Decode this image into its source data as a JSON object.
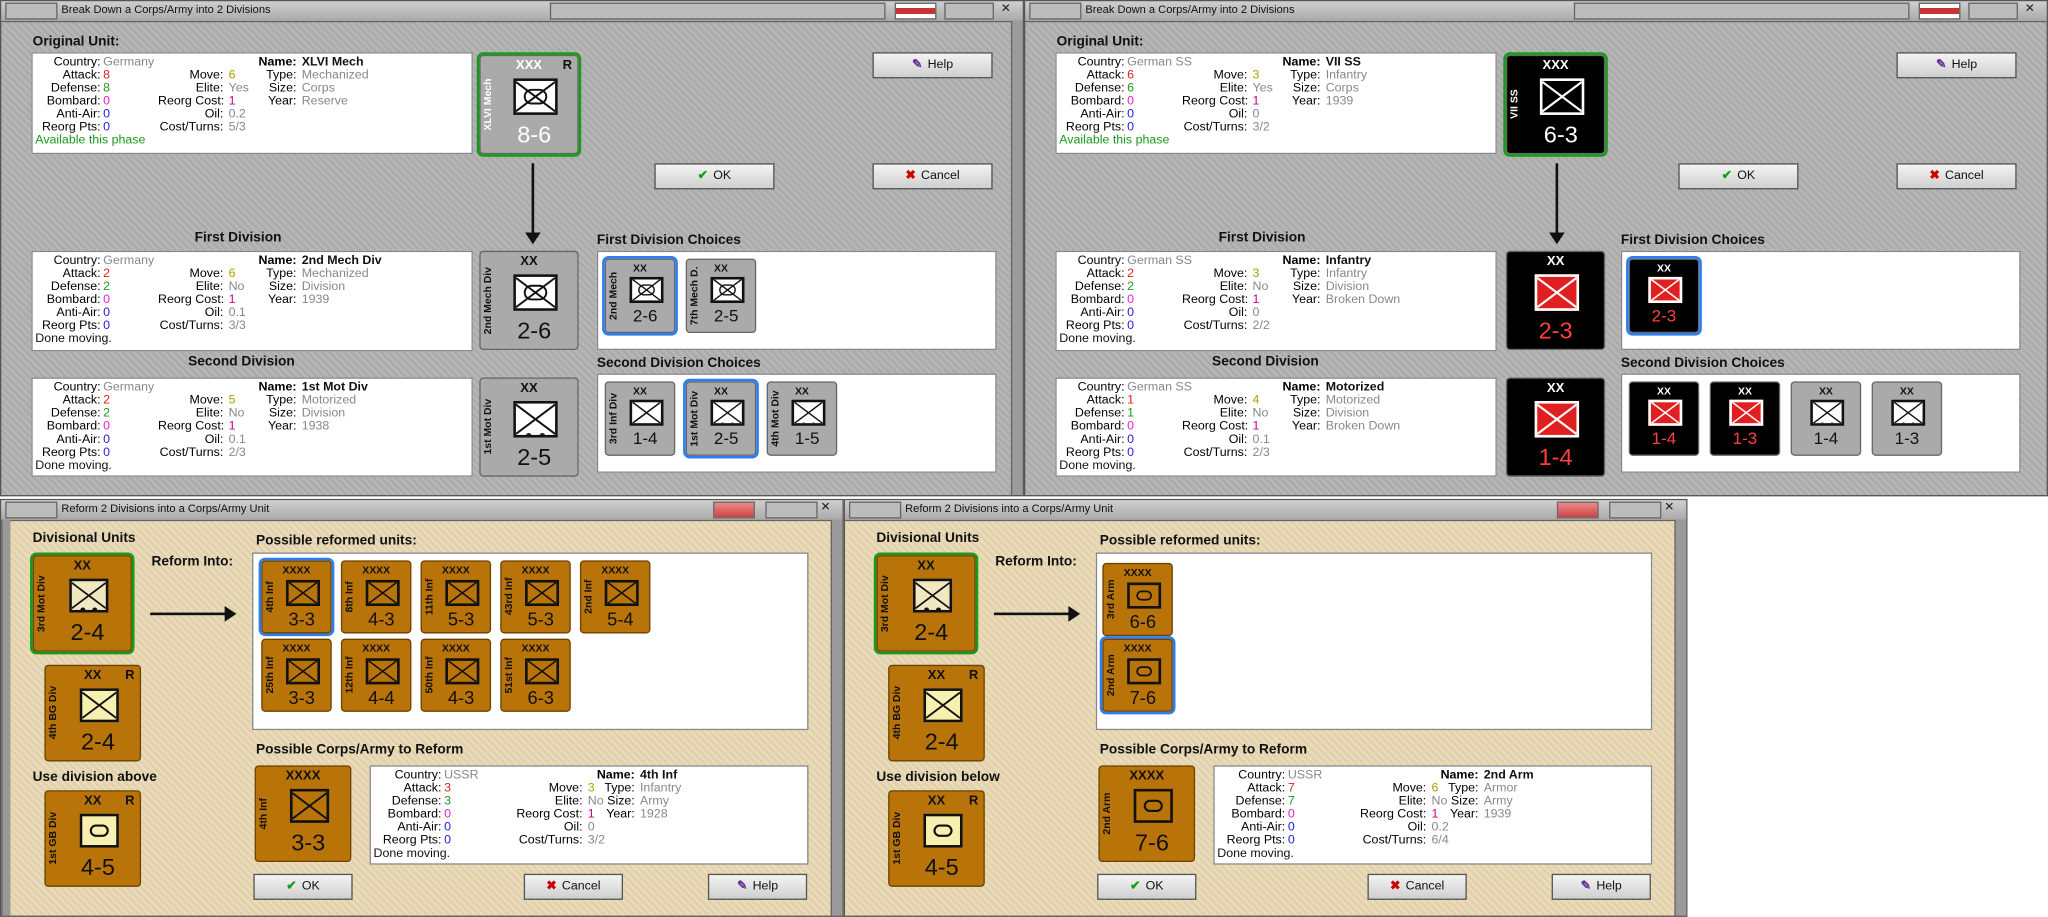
{
  "win1": {
    "title": "Break Down a Corps/Army into 2 Divisions",
    "original_label": "Original Unit:",
    "first_label": "First Division",
    "second_label": "Second Division",
    "first_choices_label": "First Division Choices",
    "second_choices_label": "Second Division Choices",
    "help": "Help",
    "ok": "OK",
    "cancel": "Cancel",
    "orig": {
      "country_l": "Country:",
      "country": "Germany",
      "attack_l": "Attack:",
      "attack": "8",
      "defense_l": "Defense:",
      "defense": "8",
      "bombard_l": "Bombard:",
      "bombard": "0",
      "antiair_l": "Anti-Air:",
      "antiair": "0",
      "reorg_l": "Reorg Pts:",
      "reorg": "0",
      "move_l": "Move:",
      "move": "6",
      "elite_l": "Elite:",
      "elite": "Yes",
      "rcost_l": "Reorg Cost:",
      "rcost": "1",
      "oil_l": "Oil:",
      "oil": "0.2",
      "ct_l": "Cost/Turns:",
      "ct": "5/3",
      "name_l": "Name:",
      "name": "XLVI Mech",
      "type_l": "Type:",
      "type": "Mechanized",
      "size_l": "Size:",
      "size": "Corps",
      "year_l": "Year:",
      "year": "Reserve",
      "status": "Available this phase"
    },
    "orig_counter": {
      "side": "XLVI Mech",
      "ech": "XXX",
      "r": "R",
      "str": "8-6"
    },
    "first": {
      "country_l": "Country:",
      "country": "Germany",
      "attack_l": "Attack:",
      "attack": "2",
      "defense_l": "Defense:",
      "defense": "2",
      "bombard_l": "Bombard:",
      "bombard": "0",
      "antiair_l": "Anti-Air:",
      "antiair": "0",
      "reorg_l": "Reorg Pts:",
      "reorg": "0",
      "move_l": "Move:",
      "move": "6",
      "elite_l": "Elite:",
      "elite": "No",
      "rcost_l": "Reorg Cost:",
      "rcost": "1",
      "oil_l": "Oil:",
      "oil": "0.1",
      "ct_l": "Cost/Turns:",
      "ct": "3/3",
      "name_l": "Name:",
      "name": "2nd Mech Div",
      "type_l": "Type:",
      "type": "Mechanized",
      "size_l": "Size:",
      "size": "Division",
      "year_l": "Year:",
      "year": "1939",
      "status": "Done moving."
    },
    "first_counter": {
      "side": "2nd Mech Div",
      "ech": "XX",
      "str": "2-6"
    },
    "second": {
      "country_l": "Country:",
      "country": "Germany",
      "attack_l": "Attack:",
      "attack": "2",
      "defense_l": "Defense:",
      "defense": "2",
      "bombard_l": "Bombard:",
      "bombard": "0",
      "antiair_l": "Anti-Air:",
      "antiair": "0",
      "reorg_l": "Reorg Pts:",
      "reorg": "0",
      "move_l": "Move:",
      "move": "5",
      "elite_l": "Elite:",
      "elite": "No",
      "rcost_l": "Reorg Cost:",
      "rcost": "1",
      "oil_l": "Oil:",
      "oil": "0.1",
      "ct_l": "Cost/Turns:",
      "ct": "2/3",
      "name_l": "Name:",
      "name": "1st Mot Div",
      "type_l": "Type:",
      "type": "Motorized",
      "size_l": "Size:",
      "size": "Division",
      "year_l": "Year:",
      "year": "1938",
      "status": "Done moving."
    },
    "second_counter": {
      "side": "1st Mot Div",
      "ech": "XX",
      "str": "2-5"
    },
    "fc": [
      {
        "side": "2nd Mech",
        "ech": "XX",
        "str": "2-6"
      },
      {
        "side": "7th Mech D.",
        "ech": "XX",
        "str": "2-5"
      }
    ],
    "sc": [
      {
        "side": "3rd Inf Div",
        "ech": "XX",
        "str": "1-4"
      },
      {
        "side": "1st Mot Div",
        "ech": "XX",
        "str": "2-5"
      },
      {
        "side": "4th Mot Div",
        "ech": "XX",
        "str": "1-5"
      }
    ]
  },
  "win2": {
    "title": "Break Down a Corps/Army into 2 Divisions",
    "original_label": "Original Unit:",
    "first_label": "First Division",
    "second_label": "Second Division",
    "first_choices_label": "First Division Choices",
    "second_choices_label": "Second Division Choices",
    "help": "Help",
    "ok": "OK",
    "cancel": "Cancel",
    "orig": {
      "country_l": "Country:",
      "country": "German SS",
      "attack_l": "Attack:",
      "attack": "6",
      "defense_l": "Defense:",
      "defense": "6",
      "bombard_l": "Bombard:",
      "bombard": "0",
      "antiair_l": "Anti-Air:",
      "antiair": "0",
      "reorg_l": "Reorg Pts:",
      "reorg": "0",
      "move_l": "Move:",
      "move": "3",
      "elite_l": "Elite:",
      "elite": "Yes",
      "rcost_l": "Reorg Cost:",
      "rcost": "1",
      "oil_l": "Oil:",
      "oil": "0",
      "ct_l": "Cost/Turns:",
      "ct": "3/2",
      "name_l": "Name:",
      "name": "VII SS",
      "type_l": "Type:",
      "type": "Infantry",
      "size_l": "Size:",
      "size": "Corps",
      "year_l": "Year:",
      "year": "1939",
      "status": "Available this phase"
    },
    "orig_counter": {
      "side": "VII SS",
      "ech": "XXX",
      "str": "6-3"
    },
    "first": {
      "country_l": "Country:",
      "country": "German SS",
      "attack_l": "Attack:",
      "attack": "2",
      "defense_l": "Defense:",
      "defense": "2",
      "bombard_l": "Bombard:",
      "bombard": "0",
      "antiair_l": "Anti-Air:",
      "antiair": "0",
      "reorg_l": "Reorg Pts:",
      "reorg": "0",
      "move_l": "Move:",
      "move": "3",
      "elite_l": "Elite:",
      "elite": "No",
      "rcost_l": "Reorg Cost:",
      "rcost": "1",
      "oil_l": "Oil:",
      "oil": "0",
      "ct_l": "Cost/Turns:",
      "ct": "2/2",
      "name_l": "Name:",
      "name": "Infantry",
      "type_l": "Type:",
      "type": "Infantry",
      "size_l": "Size:",
      "size": "Division",
      "year_l": "Year:",
      "year": "Broken Down",
      "status": "Done moving."
    },
    "first_counter": {
      "ech": "XX",
      "str": "2-3"
    },
    "second": {
      "country_l": "Country:",
      "country": "German SS",
      "attack_l": "Attack:",
      "attack": "1",
      "defense_l": "Defense:",
      "defense": "1",
      "bombard_l": "Bombard:",
      "bombard": "0",
      "antiair_l": "Anti-Air:",
      "antiair": "0",
      "reorg_l": "Reorg Pts:",
      "reorg": "0",
      "move_l": "Move:",
      "move": "4",
      "elite_l": "Elite:",
      "elite": "No",
      "rcost_l": "Reorg Cost:",
      "rcost": "1",
      "oil_l": "Oil:",
      "oil": "0.1",
      "ct_l": "Cost/Turns:",
      "ct": "2/3",
      "name_l": "Name:",
      "name": "Motorized",
      "type_l": "Type:",
      "type": "Motorized",
      "size_l": "Size:",
      "size": "Division",
      "year_l": "Year:",
      "year": "Broken Down",
      "status": "Done moving."
    },
    "second_counter": {
      "ech": "XX",
      "str": "1-4"
    },
    "fc": [
      {
        "ech": "XX",
        "str": "2-3"
      }
    ],
    "sc": [
      {
        "ech": "XX",
        "str": "1-4"
      },
      {
        "ech": "XX",
        "str": "1-3"
      },
      {
        "ech": "XX",
        "str": "1-4"
      },
      {
        "ech": "XX",
        "str": "1-3"
      }
    ]
  },
  "win3": {
    "title": "Reform 2 Divisions into a Corps/Army Unit",
    "div_units": "Divisional Units",
    "reform_into": "Reform Into:",
    "possible": "Possible reformed units:",
    "corps_label": "Possible Corps/Army to Reform",
    "use_div": "Use division above",
    "ok": "OK",
    "cancel": "Cancel",
    "help": "Help",
    "d1": {
      "side": "3rd Mot Div",
      "ech": "XX",
      "str": "2-4"
    },
    "d2": {
      "side": "4th BG Div",
      "ech": "XX",
      "r": "R",
      "str": "2-4"
    },
    "d3": {
      "side": "1st GB Div",
      "ech": "XX",
      "r": "R",
      "str": "4-5"
    },
    "units": [
      {
        "side": "4th Inf",
        "ech": "XXXX",
        "str": "3-3"
      },
      {
        "side": "8th Inf",
        "ech": "XXXX",
        "str": "4-3"
      },
      {
        "side": "11th Inf",
        "ech": "XXXX",
        "str": "5-3"
      },
      {
        "side": "43rd Inf",
        "ech": "XXXX",
        "str": "5-3"
      },
      {
        "side": "2nd Inf",
        "ech": "XXXX",
        "str": "5-4"
      },
      {
        "side": "25th Inf",
        "ech": "XXXX",
        "str": "3-3"
      },
      {
        "side": "12th Inf",
        "ech": "XXXX",
        "str": "4-4"
      },
      {
        "side": "50th Inf",
        "ech": "XXXX",
        "str": "4-3"
      },
      {
        "side": "51st Inf",
        "ech": "XXXX",
        "str": "6-3"
      }
    ],
    "corps_counter": {
      "side": "4th Inf",
      "ech": "XXXX",
      "str": "3-3"
    },
    "info": {
      "country_l": "Country:",
      "country": "USSR",
      "attack_l": "Attack:",
      "attack": "3",
      "defense_l": "Defense:",
      "defense": "3",
      "bombard_l": "Bombard:",
      "bombard": "0",
      "antiair_l": "Anti-Air:",
      "antiair": "0",
      "reorg_l": "Reorg Pts:",
      "reorg": "0",
      "move_l": "Move:",
      "move": "3",
      "elite_l": "Elite:",
      "elite": "No",
      "rcost_l": "Reorg Cost:",
      "rcost": "1",
      "oil_l": "Oil:",
      "oil": "0",
      "ct_l": "Cost/Turns:",
      "ct": "3/2",
      "name_l": "Name:",
      "name": "4th Inf",
      "type_l": "Type:",
      "type": "Infantry",
      "size_l": "Size:",
      "size": "Army",
      "year_l": "Year:",
      "year": "1928",
      "status": "Done moving."
    }
  },
  "win4": {
    "title": "Reform 2 Divisions into a Corps/Army Unit",
    "div_units": "Divisional Units",
    "reform_into": "Reform Into:",
    "possible": "Possible reformed units:",
    "corps_label": "Possible Corps/Army to Reform",
    "use_div": "Use division below",
    "ok": "OK",
    "cancel": "Cancel",
    "help": "Help",
    "d1": {
      "side": "3rd Mot Div",
      "ech": "XX",
      "str": "2-4"
    },
    "d2": {
      "side": "4th BG Div",
      "ech": "XX",
      "r": "R",
      "str": "2-4"
    },
    "d3": {
      "side": "1st GB Div",
      "ech": "XX",
      "r": "R",
      "str": "4-5"
    },
    "units": [
      {
        "side": "3rd Arm",
        "ech": "XXXX",
        "str": "6-6"
      },
      {
        "side": "2nd Arm",
        "ech": "XXXX",
        "str": "7-6"
      }
    ],
    "corps_counter": {
      "side": "2nd Arm",
      "ech": "XXXX",
      "str": "7-6"
    },
    "info": {
      "country_l": "Country:",
      "country": "USSR",
      "attack_l": "Attack:",
      "attack": "7",
      "defense_l": "Defense:",
      "defense": "7",
      "bombard_l": "Bombard:",
      "bombard": "0",
      "antiair_l": "Anti-Air:",
      "antiair": "0",
      "reorg_l": "Reorg Pts:",
      "reorg": "0",
      "move_l": "Move:",
      "move": "6",
      "elite_l": "Elite:",
      "elite": "No",
      "rcost_l": "Reorg Cost:",
      "rcost": "1",
      "oil_l": "Oil:",
      "oil": "0.2",
      "ct_l": "Cost/Turns:",
      "ct": "6/4",
      "name_l": "Name:",
      "name": "2nd Arm",
      "type_l": "Type:",
      "type": "Armor",
      "size_l": "Size:",
      "size": "Army",
      "year_l": "Year:",
      "year": "1939",
      "status": "Done moving."
    }
  },
  "colors": {
    "attack": "#e02020",
    "defense": "#1a9a1a",
    "bombard": "#e020e0",
    "antiair": "#2020e0",
    "reorg": "#2020e0",
    "move": "#b0a000",
    "rcost": "#d00080",
    "status_avail": "#1a9a1a",
    "selection": "#2c7ef0",
    "counter_brown": "#b87309",
    "counter_gray": "#aaaaaa",
    "counter_black": "#000000"
  }
}
